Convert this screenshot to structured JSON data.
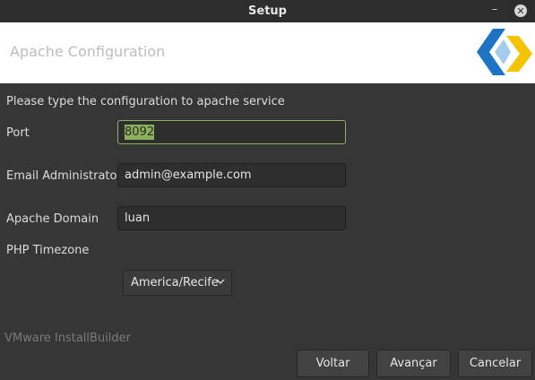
{
  "window": {
    "title": "Setup",
    "minimize_icon": "minimize-icon",
    "close_icon": "close-icon"
  },
  "header": {
    "title": "Apache Configuration",
    "logo_icon": "installbuilder-logo",
    "logo_colors": [
      "#1e74c4",
      "#f5c400"
    ]
  },
  "form": {
    "subtitle": "Please type the configuration to apache service",
    "port": {
      "label": "Port",
      "value": "8092"
    },
    "email": {
      "label": "Email Administrator",
      "value": "admin@example.com"
    },
    "domain": {
      "label": "Apache Domain",
      "value": "luan"
    },
    "timezone": {
      "label": "PHP Timezone",
      "selected": "America/Recife"
    }
  },
  "footer": {
    "brand": "VMware InstallBuilder",
    "back_label": "Voltar",
    "next_label": "Avançar",
    "cancel_label": "Cancelar"
  },
  "colors": {
    "accent": "#8bb15a",
    "background": "#363636"
  }
}
